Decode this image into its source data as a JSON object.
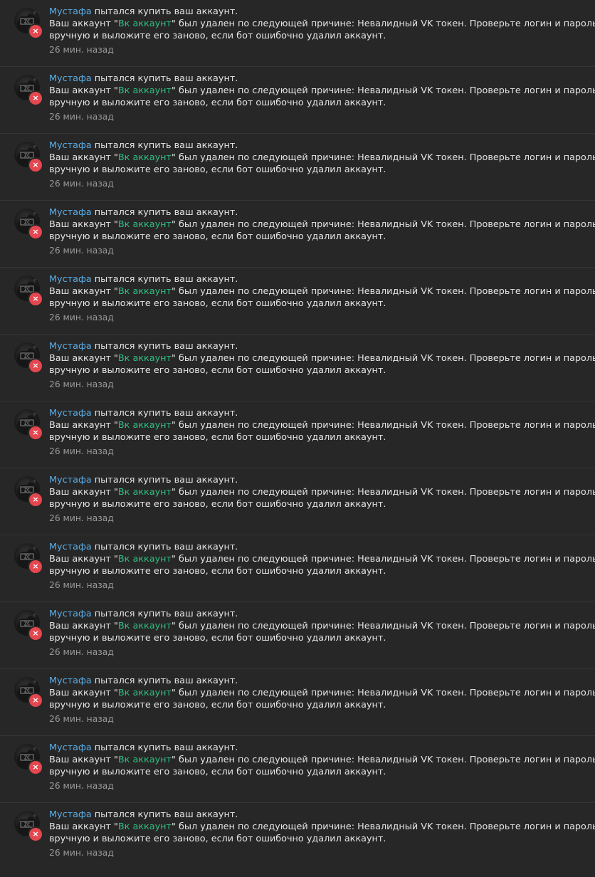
{
  "colors": {
    "background": "#272727",
    "divider": "#353535",
    "text": "#e4e4e4",
    "username": "#5aaee8",
    "account_link": "#2fbf83",
    "timestamp": "#9a9a9a",
    "error_badge": "#e4474f"
  },
  "icons": {
    "avatar": "avatar-image",
    "status": "error-x-icon"
  },
  "notifications": [
    {
      "user": "Мустафа",
      "action": " пытался купить ваш аккаунт.",
      "msg_prefix": "Ваш аккаунт \"",
      "account": "Вк аккаунт",
      "msg_reason_1": "\" был удален по следующей причине: Невалидный VK токен. Проверьте логин и пароль",
      "msg_reason_2": "вручную и выложите его заново, если бот ошибочно удалил аккаунт.",
      "time": "26 мин. назад",
      "badge": "×"
    },
    {
      "user": "Мустафа",
      "action": " пытался купить ваш аккаунт.",
      "msg_prefix": "Ваш аккаунт \"",
      "account": "Вк аккаунт",
      "msg_reason_1": "\" был удален по следующей причине: Невалидный VK токен. Проверьте логин и пароль",
      "msg_reason_2": "вручную и выложите его заново, если бот ошибочно удалил аккаунт.",
      "time": "26 мин. назад",
      "badge": "×"
    },
    {
      "user": "Мустафа",
      "action": " пытался купить ваш аккаунт.",
      "msg_prefix": "Ваш аккаунт \"",
      "account": "Вк аккаунт",
      "msg_reason_1": "\" был удален по следующей причине: Невалидный VK токен. Проверьте логин и пароль",
      "msg_reason_2": "вручную и выложите его заново, если бот ошибочно удалил аккаунт.",
      "time": "26 мин. назад",
      "badge": "×"
    },
    {
      "user": "Мустафа",
      "action": " пытался купить ваш аккаунт.",
      "msg_prefix": "Ваш аккаунт \"",
      "account": "Вк аккаунт",
      "msg_reason_1": "\" был удален по следующей причине: Невалидный VK токен. Проверьте логин и пароль",
      "msg_reason_2": "вручную и выложите его заново, если бот ошибочно удалил аккаунт.",
      "time": "26 мин. назад",
      "badge": "×"
    },
    {
      "user": "Мустафа",
      "action": " пытался купить ваш аккаунт.",
      "msg_prefix": "Ваш аккаунт \"",
      "account": "Вк аккаунт",
      "msg_reason_1": "\" был удален по следующей причине: Невалидный VK токен. Проверьте логин и пароль",
      "msg_reason_2": "вручную и выложите его заново, если бот ошибочно удалил аккаунт.",
      "time": "26 мин. назад",
      "badge": "×"
    },
    {
      "user": "Мустафа",
      "action": " пытался купить ваш аккаунт.",
      "msg_prefix": "Ваш аккаунт \"",
      "account": "Вк аккаунт",
      "msg_reason_1": "\" был удален по следующей причине: Невалидный VK токен. Проверьте логин и пароль",
      "msg_reason_2": "вручную и выложите его заново, если бот ошибочно удалил аккаунт.",
      "time": "26 мин. назад",
      "badge": "×"
    },
    {
      "user": "Мустафа",
      "action": " пытался купить ваш аккаунт.",
      "msg_prefix": "Ваш аккаунт \"",
      "account": "Вк аккаунт",
      "msg_reason_1": "\" был удален по следующей причине: Невалидный VK токен. Проверьте логин и пароль",
      "msg_reason_2": "вручную и выложите его заново, если бот ошибочно удалил аккаунт.",
      "time": "26 мин. назад",
      "badge": "×"
    },
    {
      "user": "Мустафа",
      "action": " пытался купить ваш аккаунт.",
      "msg_prefix": "Ваш аккаунт \"",
      "account": "Вк аккаунт",
      "msg_reason_1": "\" был удален по следующей причине: Невалидный VK токен. Проверьте логин и пароль",
      "msg_reason_2": "вручную и выложите его заново, если бот ошибочно удалил аккаунт.",
      "time": "26 мин. назад",
      "badge": "×"
    },
    {
      "user": "Мустафа",
      "action": " пытался купить ваш аккаунт.",
      "msg_prefix": "Ваш аккаунт \"",
      "account": "Вк аккаунт",
      "msg_reason_1": "\" был удален по следующей причине: Невалидный VK токен. Проверьте логин и пароль",
      "msg_reason_2": "вручную и выложите его заново, если бот ошибочно удалил аккаунт.",
      "time": "26 мин. назад",
      "badge": "×"
    },
    {
      "user": "Мустафа",
      "action": " пытался купить ваш аккаунт.",
      "msg_prefix": "Ваш аккаунт \"",
      "account": "Вк аккаунт",
      "msg_reason_1": "\" был удален по следующей причине: Невалидный VK токен. Проверьте логин и пароль",
      "msg_reason_2": "вручную и выложите его заново, если бот ошибочно удалил аккаунт.",
      "time": "26 мин. назад",
      "badge": "×"
    },
    {
      "user": "Мустафа",
      "action": " пытался купить ваш аккаунт.",
      "msg_prefix": "Ваш аккаунт \"",
      "account": "Вк аккаунт",
      "msg_reason_1": "\" был удален по следующей причине: Невалидный VK токен. Проверьте логин и пароль",
      "msg_reason_2": "вручную и выложите его заново, если бот ошибочно удалил аккаунт.",
      "time": "26 мин. назад",
      "badge": "×"
    },
    {
      "user": "Мустафа",
      "action": " пытался купить ваш аккаунт.",
      "msg_prefix": "Ваш аккаунт \"",
      "account": "Вк аккаунт",
      "msg_reason_1": "\" был удален по следующей причине: Невалидный VK токен. Проверьте логин и пароль",
      "msg_reason_2": "вручную и выложите его заново, если бот ошибочно удалил аккаунт.",
      "time": "26 мин. назад",
      "badge": "×"
    },
    {
      "user": "Мустафа",
      "action": " пытался купить ваш аккаунт.",
      "msg_prefix": "Ваш аккаунт \"",
      "account": "Вк аккаунт",
      "msg_reason_1": "\" был удален по следующей причине: Невалидный VK токен. Проверьте логин и пароль",
      "msg_reason_2": "вручную и выложите его заново, если бот ошибочно удалил аккаунт.",
      "time": "26 мин. назад",
      "badge": "×"
    }
  ]
}
